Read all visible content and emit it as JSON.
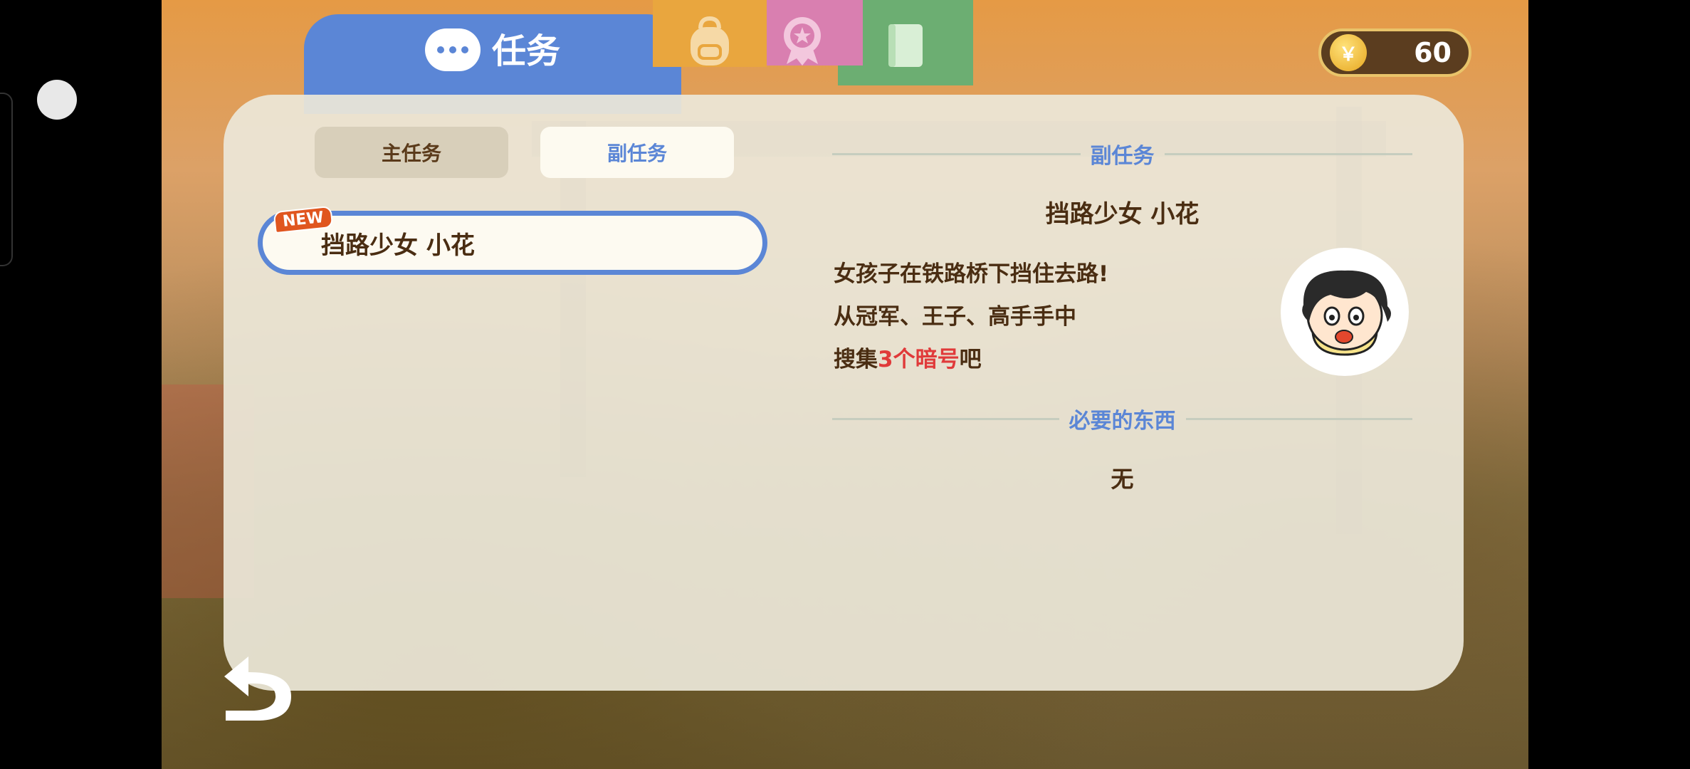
{
  "tabs": {
    "quests_label": "任务",
    "bag_icon": "backpack-icon",
    "medal_icon": "medal-icon",
    "book_icon": "book-icon"
  },
  "coins": {
    "icon": "yen-coin-icon",
    "symbol": "￥",
    "count": "60"
  },
  "categories": {
    "main": "主任务",
    "side": "副任务"
  },
  "quest_list": [
    {
      "badge": "NEW",
      "title": "挡路少女 小花",
      "selected": true
    }
  ],
  "detail": {
    "section_label": "副任务",
    "title": "挡路少女 小花",
    "lines": [
      "女孩子在铁路桥下挡住去路!",
      "从冠军、王子、高手手中"
    ],
    "line3_before": "搜集",
    "line3_highlight": "3个暗号",
    "line3_after": "吧",
    "required_label": "必要的东西",
    "required_value": "无"
  },
  "colors": {
    "accent_blue": "#5b86d6",
    "text_brown": "#4a2d12",
    "highlight_red": "#e03a3a",
    "tab_orange": "#e9a63e",
    "tab_pink": "#d97fb0",
    "tab_green": "#6cae72"
  }
}
